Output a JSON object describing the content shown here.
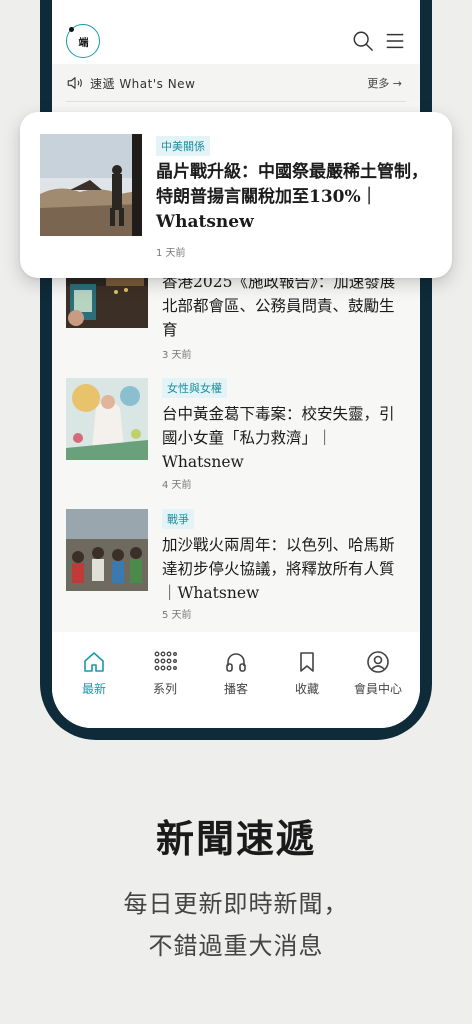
{
  "app": {
    "logo_text": "端",
    "accent_color": "#1a9aa8",
    "icons": [
      "search-icon",
      "menu-icon",
      "speaker-icon",
      "arrow-right-icon"
    ]
  },
  "now_bar": {
    "label": "速遞 What's New",
    "more": "更多 →"
  },
  "featured": {
    "tag": "中美關係",
    "title": "晶片戰升級：中國祭最嚴稀土管制，特朗普揚言關稅加至130%｜Whatsnew",
    "time": "1 天前"
  },
  "articles": [
    {
      "tag": "",
      "title": "香港2025《施政報告》：加速發展北部都會區、公務員問責、鼓勵生育",
      "time": "3 天前"
    },
    {
      "tag": "女性與女權",
      "title": "台中黃金葛下毒案：校安失靈，引國小女童「私力救濟」｜Whatsnew",
      "time": "4 天前"
    },
    {
      "tag": "戰爭",
      "title": "加沙戰火兩周年：以色列、哈馬斯達初步停火協議，將釋放所有人質｜Whatsnew",
      "time": "5 天前"
    }
  ],
  "tabs": [
    {
      "label": "最新",
      "icon": "home-icon",
      "active": true
    },
    {
      "label": "系列",
      "icon": "grid-icon",
      "active": false
    },
    {
      "label": "播客",
      "icon": "headphones-icon",
      "active": false
    },
    {
      "label": "收藏",
      "icon": "bookmark-icon",
      "active": false
    },
    {
      "label": "會員中心",
      "icon": "user-icon",
      "active": false
    }
  ],
  "promo": {
    "headline": "新聞速遞",
    "line1": "每日更新即時新聞，",
    "line2": "不錯過重大消息"
  }
}
